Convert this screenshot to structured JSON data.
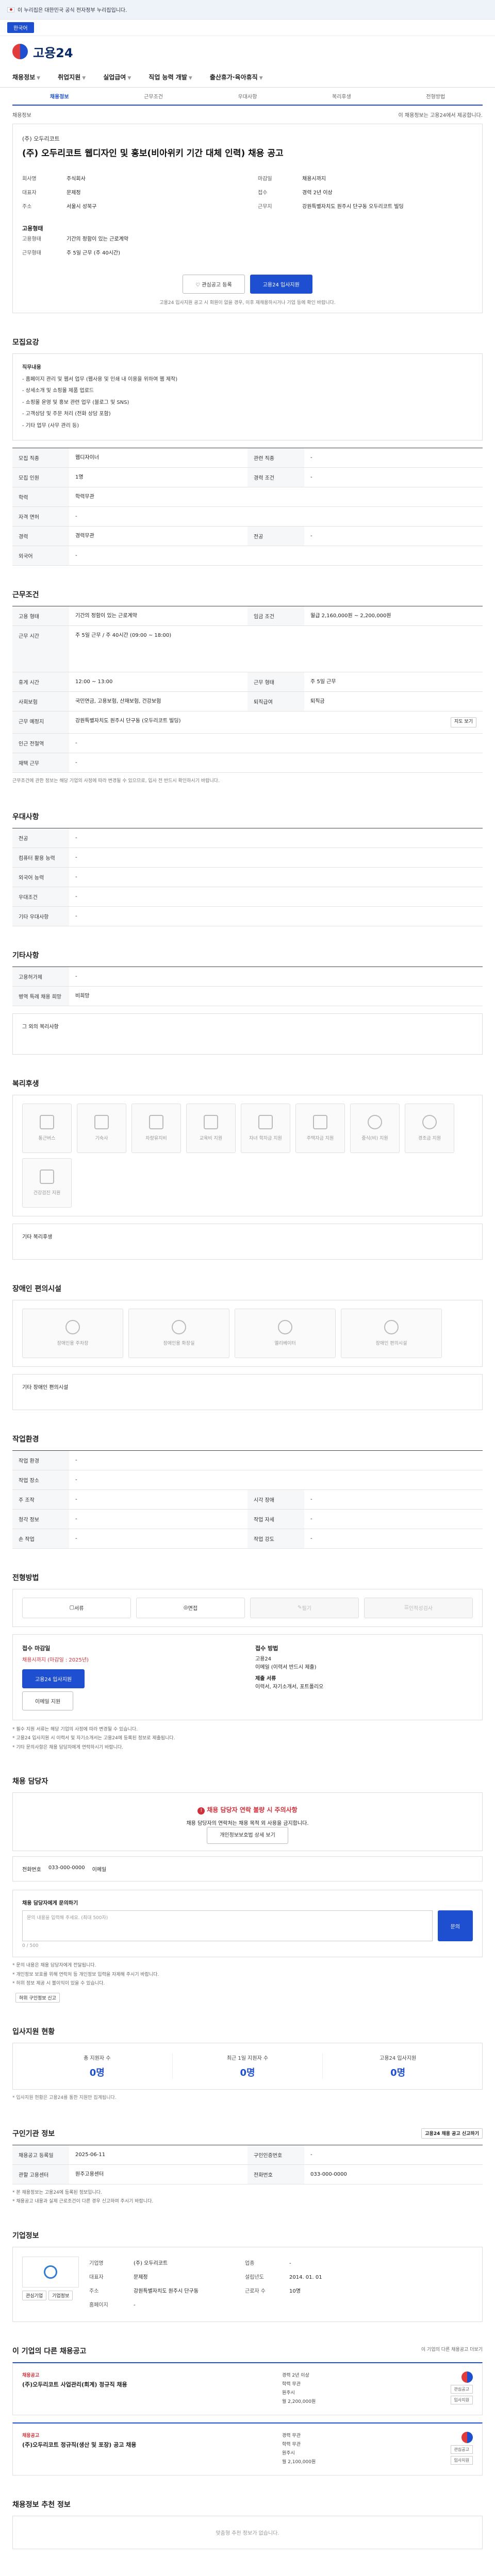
{
  "topbar": {
    "gov_notice": "이 누리집은 대한민국 공식 전자정부 누리집입니다.",
    "lang": "한국어"
  },
  "header": {
    "logo": "고용24"
  },
  "gnb": [
    "채용정보",
    "취업지원",
    "실업급여",
    "직업 능력 개발",
    "출산휴가·육아휴직"
  ],
  "subtabs": [
    "채용정보",
    "근무조건",
    "우대사항",
    "복리후생",
    "전형방법"
  ],
  "notice_bar": {
    "left": "채용정보",
    "right": "이 채용정보는 고용24에서 제공합니다."
  },
  "title_block": {
    "company": "(주) 오두리코트",
    "title": "(주) 오두리코트 웹디자인 및 홍보(비아위키 기간 대체 인력) 채용 공고",
    "left": [
      {
        "k": "회사명",
        "v": "주식회사"
      },
      {
        "k": "대표자",
        "v": "문제정"
      },
      {
        "k": "주소",
        "v": "서울시 성북구"
      }
    ],
    "right": [
      {
        "k": "마감일",
        "v": "채용시까지"
      },
      {
        "k": "접수",
        "v": "경력 2년 이상"
      },
      {
        "k": "근무지",
        "v": "강원특별자치도 원주시 단구동 오두리코트 빌딩"
      }
    ],
    "sub_heading": "고용형태",
    "sub_items": [
      {
        "k": "고용형태",
        "v": "기간의 정함이 있는 근로계약"
      },
      {
        "k": "근무형태",
        "v": "주 5일 근무 (주 40시간)"
      }
    ],
    "btn_scrap": "관심공고 등록",
    "btn_apply": "고용24 입사지원",
    "note": "고용24 입사지원 공고 시 회원이 없을 경우, 이후 재채용하시거나 기업 등에 확인 바랍니다."
  },
  "sec_job": {
    "title": "모집요강",
    "lines": [
      "직무내용",
      "- 홈페이지 관리 및 웹서 업무 (웹사용 및 인쇄 내 이용을 위하여 웹 제작)",
      "- 상세소개 및 쇼핑몰 제품 업로드",
      "- 쇼핑몰 운영 및 홍보 관련 업무 (블로그 및 SNS)",
      "- 고객상담 및 주문 처리 (전화 상담 포함)",
      "- 기타 업무 (사무 관리 등)"
    ],
    "rows": [
      [
        {
          "k": "모집 직종",
          "v": "웹디자이너"
        },
        {
          "k": "관련 직종",
          "v": "-"
        }
      ],
      [
        {
          "k": "모집 인원",
          "v": "1명"
        },
        {
          "k": "경력 조건",
          "v": "-"
        }
      ],
      [
        {
          "k": "학력",
          "v": "학력무관"
        },
        {
          "k": "",
          "v": ""
        }
      ],
      [
        {
          "k": "자격 면허",
          "v": "-"
        },
        {
          "k": "",
          "v": ""
        }
      ],
      [
        {
          "k": "경력",
          "v": "경력무관"
        },
        {
          "k": "전공",
          "v": "-"
        }
      ],
      [
        {
          "k": "외국어",
          "v": "-"
        },
        {
          "k": "",
          "v": ""
        }
      ]
    ]
  },
  "sec_cond": {
    "title": "근무조건",
    "rows": [
      [
        {
          "k": "고용 형태",
          "v": "기간의 정함이 있는 근로계약"
        },
        {
          "k": "임금 조건",
          "v": "월급 2,160,000원 ~ 2,200,000원"
        }
      ],
      [
        {
          "k": "근무 시간",
          "v": "주 5일 근무 / 주 40시간 (09:00 ~ 18:00)"
        },
        {
          "k": "",
          "v": ""
        }
      ],
      [
        {
          "k": "휴게 시간",
          "v": "12:00 ~ 13:00"
        },
        {
          "k": "근무 형태",
          "v": "주 5일 근무"
        }
      ],
      [
        {
          "k": "사회보험",
          "v": "국민연금, 고용보험, 산재보험, 건강보험"
        },
        {
          "k": "퇴직급여",
          "v": "퇴직금"
        }
      ],
      [
        {
          "k": "근무 예정지",
          "v": "강원특별자치도 원주시 단구동 (오두리코트 빌딩)"
        },
        {
          "k": "",
          "v": ""
        }
      ],
      [
        {
          "k": "인근 전철역",
          "v": "-"
        },
        {
          "k": "",
          "v": ""
        }
      ],
      [
        {
          "k": "재택 근무",
          "v": "-"
        },
        {
          "k": "",
          "v": ""
        }
      ]
    ],
    "map_btn": "지도 보기",
    "note": "근무조건에 관한 정보는 해당 기업의 사정에 따라 변경될 수 있으므로, 입사 전 반드시 확인하시기 바랍니다."
  },
  "sec_pref": {
    "title": "우대사항",
    "rows": [
      {
        "k": "전공",
        "v": "-"
      },
      {
        "k": "컴퓨터 활용 능력",
        "v": "-"
      },
      {
        "k": "외국어 능력",
        "v": "-"
      },
      {
        "k": "우대조건",
        "v": "-"
      },
      {
        "k": "기타 우대사항",
        "v": "-"
      }
    ]
  },
  "sec_etc": {
    "title": "기타사항",
    "rows": [
      {
        "k": "고용허가제",
        "v": "-"
      },
      {
        "k": "병역 특례 채용 희망",
        "v": "비희망"
      }
    ],
    "extra": "그 외의 복리사항"
  },
  "sec_welfare": {
    "title": "복리후생",
    "cards": [
      "통근버스",
      "기숙사",
      "차량유지비",
      "교육비 지원",
      "자녀 학자금 지원",
      "주택자금 지원",
      "중식(비) 지원",
      "경조금 지원",
      "건강검진 지원"
    ],
    "extra": "기타 복리후생"
  },
  "sec_disabled": {
    "title": "장애인 편의시설",
    "cards": [
      "장애인용 주차장",
      "장애인용 화장실",
      "엘리베이터",
      "장애인 편의시설"
    ],
    "extra": "기타 장애인 편의시설"
  },
  "sec_env": {
    "title": "작업환경",
    "rows": [
      [
        {
          "k": "작업 환경",
          "v": "-"
        },
        {
          "k": "",
          "v": ""
        }
      ],
      [
        {
          "k": "작업 장소",
          "v": "-"
        },
        {
          "k": "",
          "v": ""
        }
      ],
      [
        {
          "k": "주 조작",
          "v": "-"
        },
        {
          "k": "시각 장애",
          "v": "-"
        }
      ],
      [
        {
          "k": "청각 정보",
          "v": "-"
        },
        {
          "k": "작업 자세",
          "v": "-"
        }
      ],
      [
        {
          "k": "손 작업",
          "v": "-"
        },
        {
          "k": "작업 강도",
          "v": "-"
        }
      ]
    ]
  },
  "sec_method": {
    "title": "전형방법",
    "steps": [
      "서류",
      "면접",
      "필기",
      "인적성검사"
    ],
    "apply_label": "접수 마감일",
    "apply_red": "채용시까지 (마감일 : 2025년)",
    "apply_btn": "고용24 입사지원",
    "email_btn": "이메일 지원",
    "docs_label": "접수 방법",
    "docs": [
      "고용24",
      "이메일 (이력서 반드시 제출)",
      "제출 서류",
      "이력서, 자기소개서, 포트폴리오"
    ],
    "bullets": [
      "* 필수 지원 서류는 해당 기업의 사정에 따라 변경될 수 있습니다.",
      "* 고용24 입사지원 시 이력서 및 자기소개서는 고용24에 등록된 정보로 제출됩니다.",
      "* 기타 문의사항은 채용 담당자에게 연락하시기 바랍니다."
    ]
  },
  "sec_contact": {
    "title": "채용 담당자",
    "alert": "채용 담당자 연락 불량 시 주의사항",
    "alert_sub": "채용 담당자의 연락처는 채용 목적 외 사용을 금지합니다.",
    "alert_btn": "개인정보보호법 상세 보기",
    "phone_label": "전화번호",
    "phone": "033-000-0000",
    "fax_label": "이메일",
    "inquiry_label": "채용 담당자에게 문의하기",
    "inquiry_placeholder": "문의 내용을 입력해 주세요. (최대 500자)",
    "inquiry_btn": "문의",
    "inquiry_count": "0 / 500",
    "notes": [
      "* 문의 내용은 채용 담당자에게 전달됩니다.",
      "* 개인정보 보호를 위해 연락처 등 개인정보 입력을 자제해 주시기 바랍니다.",
      "* 허위 정보 제공 시 불이익이 있을 수 있습니다."
    ],
    "report_btn": "허위 구인정보 신고"
  },
  "sec_stats": {
    "title": "입사지원 현황",
    "items": [
      {
        "label": "총 지원자 수",
        "value": "0명"
      },
      {
        "label": "최근 1일 지원자 수",
        "value": "0명"
      },
      {
        "label": "고용24 입사지원",
        "value": "0명"
      }
    ],
    "note": "* 입사지원 현황은 고용24를 통한 지원만 집계됩니다."
  },
  "sec_info": {
    "title": "구인기관 정보",
    "rows": [
      [
        {
          "k": "채용공고 등록일",
          "v": "2025-06-11"
        },
        {
          "k": "구인인증번호",
          "v": "-"
        }
      ],
      [
        {
          "k": "관할 고용센터",
          "v": "원주고용센터"
        },
        {
          "k": "전화번호",
          "v": "033-000-0000"
        }
      ]
    ],
    "btn": "고용24 채용 공고 신고하기",
    "notes": [
      "* 본 채용정보는 고용24에 등록된 정보입니다.",
      "* 채용공고 내용과 실제 근로조건이 다른 경우 신고하여 주시기 바랍니다."
    ]
  },
  "sec_company": {
    "title": "기업정보",
    "logo_btns": [
      "관심기업",
      "기업정보"
    ],
    "rows": [
      [
        {
          "k": "기업명",
          "v": "(주) 오두리코트"
        },
        {
          "k": "업종",
          "v": "-"
        }
      ],
      [
        {
          "k": "대표자",
          "v": "문제정"
        },
        {
          "k": "설립년도",
          "v": "2014. 01. 01"
        }
      ],
      [
        {
          "k": "주소",
          "v": "강원특별자치도 원주시 단구동"
        },
        {
          "k": "근로자 수",
          "v": "10명"
        }
      ],
      [
        {
          "k": "홈페이지",
          "v": "-"
        },
        {
          "k": "",
          "v": ""
        }
      ]
    ]
  },
  "sec_other": {
    "title": "이 기업의 다른 채용공고",
    "more": "이 기업의 다른 채용공고 더보기",
    "cards": [
      {
        "tag": "채용공고",
        "title": "(주)오두리코트 사업관리(회계) 정규직 채용",
        "mid": [
          "경력 2년 이상",
          "학력 무관",
          "원주시",
          "월 2,200,000원"
        ],
        "btns": [
          "관심공고",
          "입사지원"
        ]
      },
      {
        "tag": "채용공고",
        "title": "(주)오두리코트 정규직(생산 및 포장) 공고 채용",
        "mid": [
          "경력 무관",
          "학력 무관",
          "원주시",
          "월 2,100,000원"
        ],
        "btns": [
          "관심공고",
          "입사지원"
        ]
      }
    ]
  },
  "sec_recommend": {
    "title": "채용정보 추천 정보",
    "text": "맞춤형 추천 정보가 없습니다."
  }
}
